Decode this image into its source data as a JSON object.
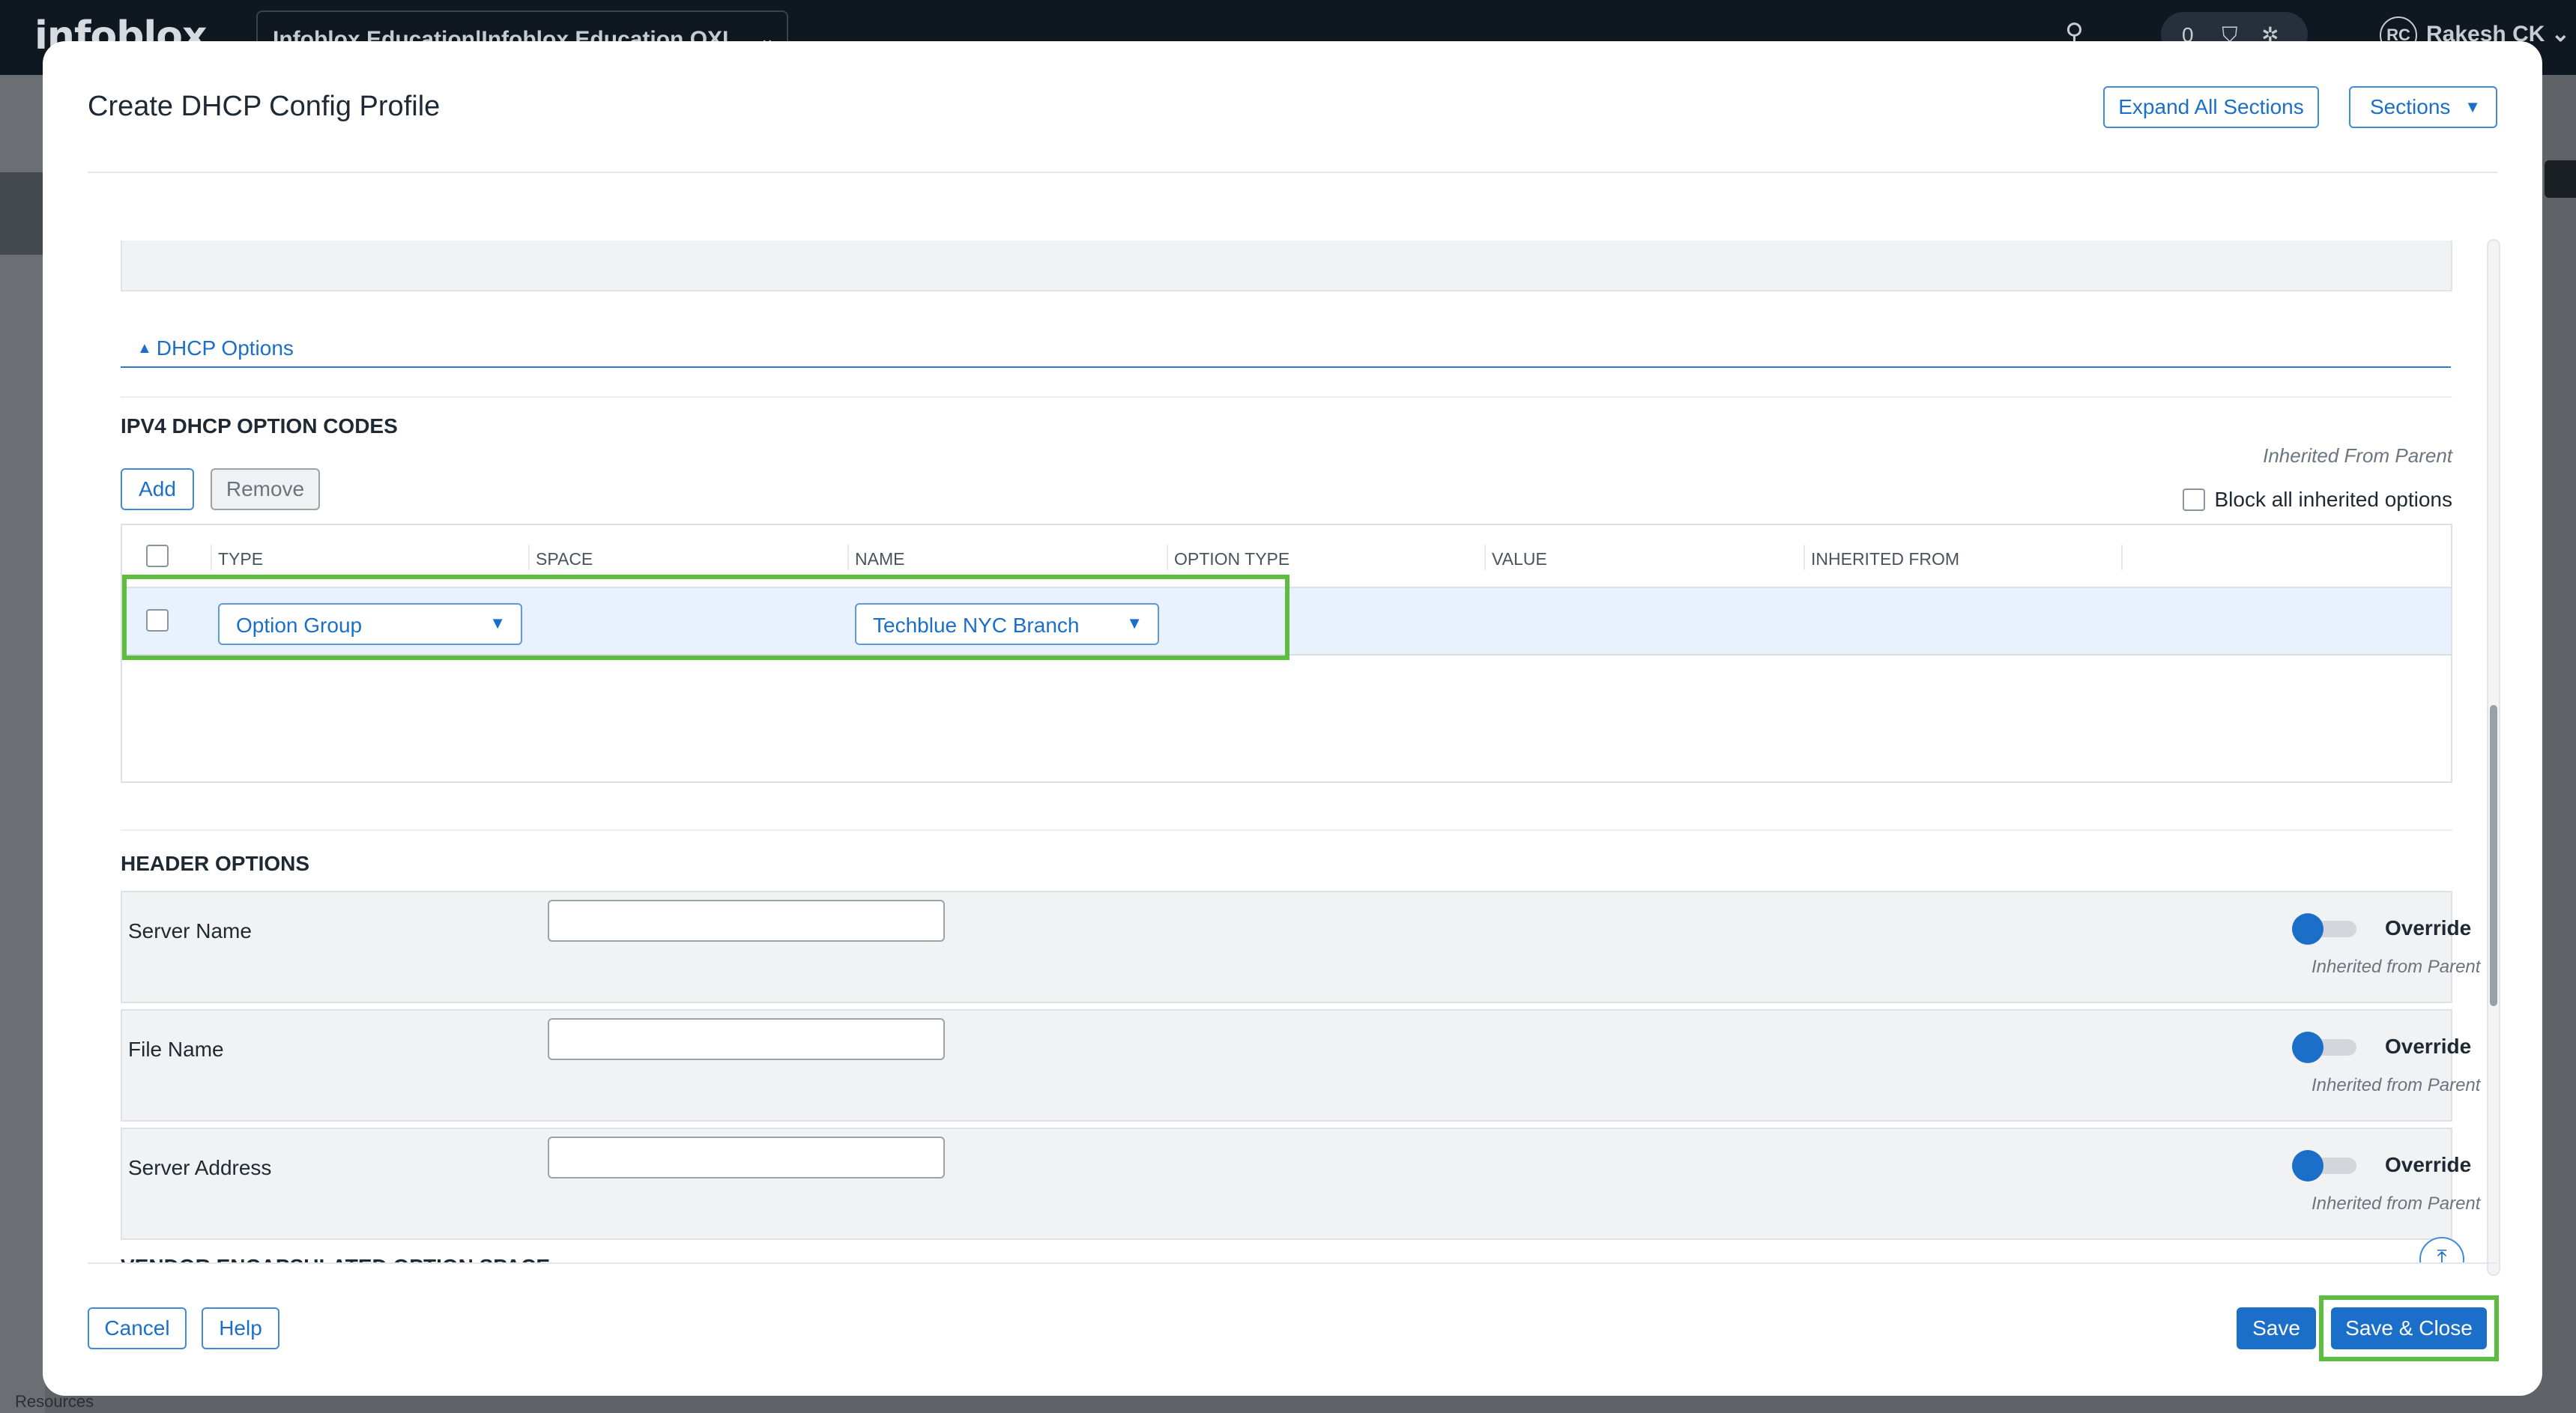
{
  "background": {
    "brand": "infoblox",
    "org_selector": "Infoblox Education|Infoblox Education OXL",
    "counter": "0",
    "user_initials": "RC",
    "user_name": "Rakesh CK",
    "resources_label": "Resources"
  },
  "modal": {
    "title": "Create DHCP Config Profile",
    "expand_all_label": "Expand All Sections",
    "sections_label": "Sections"
  },
  "dhcp_options": {
    "header": "DHCP Options",
    "ipv4_title": "IPV4 DHCP OPTION CODES",
    "inherited_from_parent": "Inherited From Parent",
    "block_all_label": "Block all inherited options",
    "add_label": "Add",
    "remove_label": "Remove",
    "columns": [
      "TYPE",
      "SPACE",
      "NAME",
      "OPTION TYPE",
      "VALUE",
      "INHERITED FROM"
    ],
    "row": {
      "type": "Option Group",
      "name": "Techblue NYC Branch"
    }
  },
  "header_options": {
    "title": "HEADER OPTIONS",
    "rows": [
      {
        "label": "Server Name",
        "override": "Override",
        "note": "Inherited from Parent"
      },
      {
        "label": "File Name",
        "override": "Override",
        "note": "Inherited from Parent"
      },
      {
        "label": "Server Address",
        "override": "Override",
        "note": "Inherited from Parent"
      }
    ]
  },
  "vendor_title": "VENDOR ENCAPSULATED OPTION SPACE",
  "footer": {
    "cancel_label": "Cancel",
    "help_label": "Help",
    "save_label": "Save",
    "save_close_label": "Save & Close"
  },
  "colors": {
    "accent": "#1b6fc9",
    "highlight": "#5cbd3f"
  }
}
